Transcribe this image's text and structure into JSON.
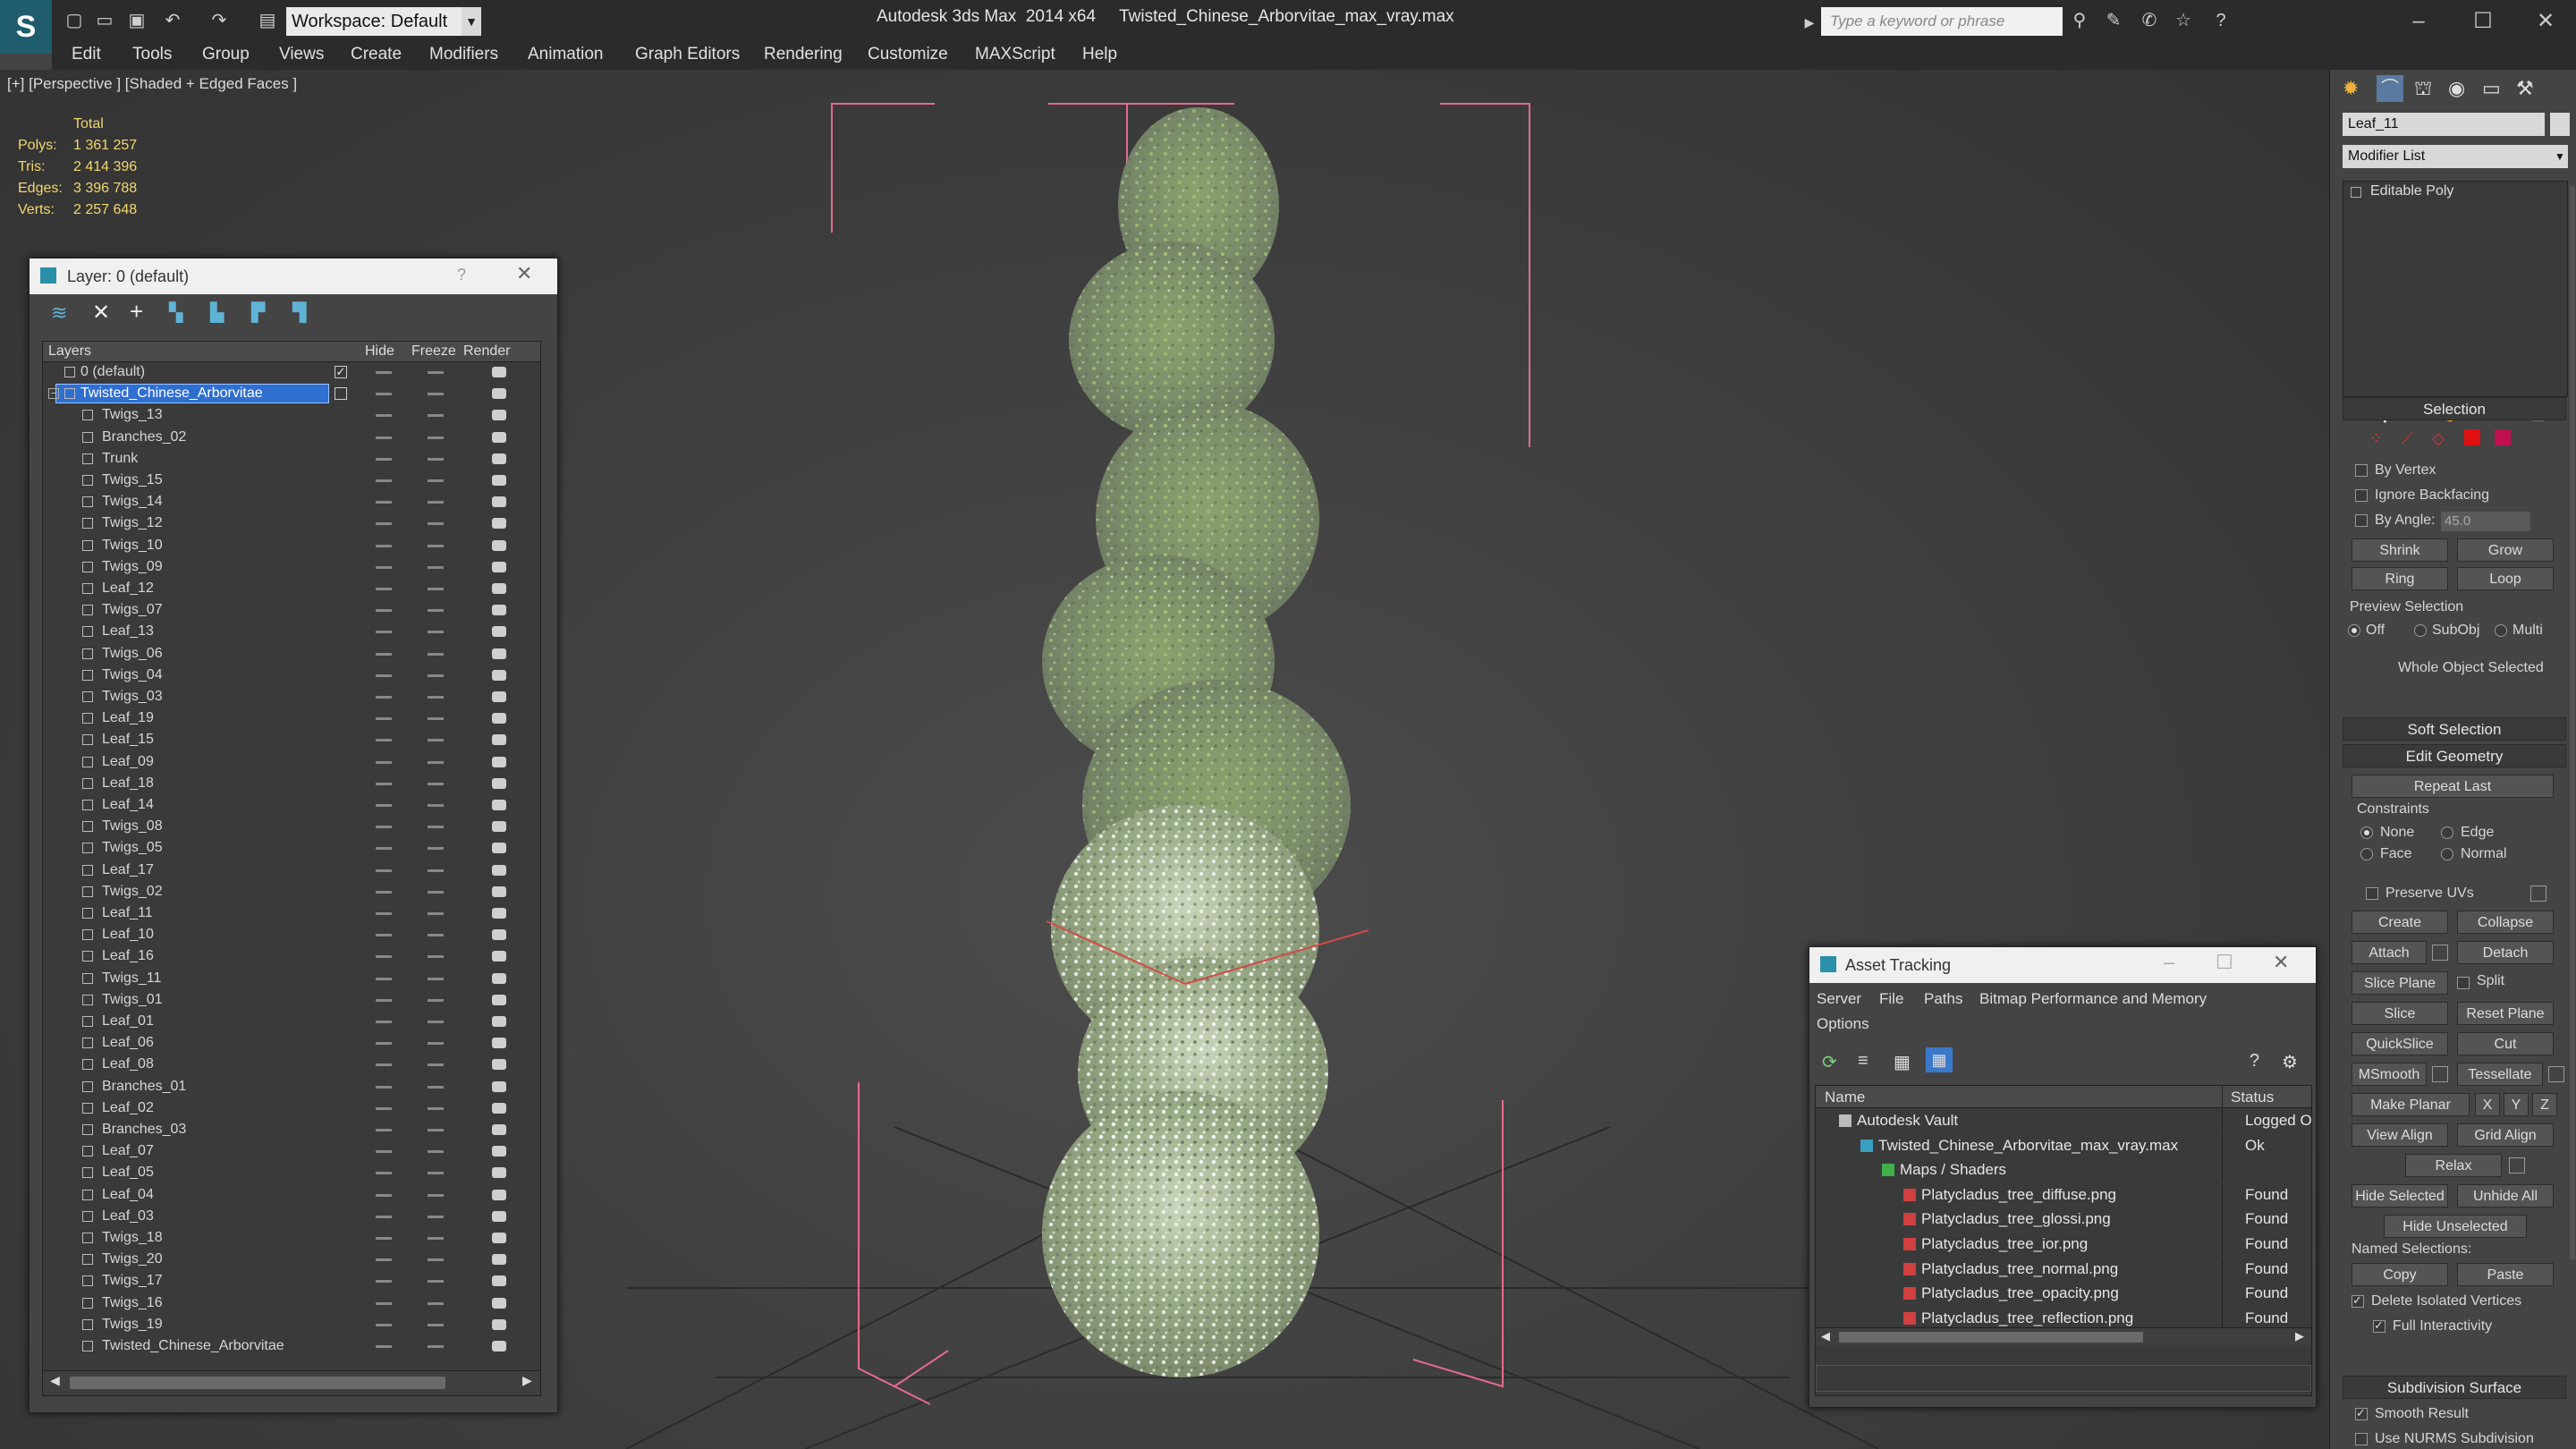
{
  "window": {
    "app_title": "Autodesk 3ds Max  2014 x64",
    "file_title": "Twisted_Chinese_Arborvitae_max_vray.max",
    "workspace": "Workspace: Default",
    "search_placeholder": "Type a keyword or phrase"
  },
  "menu": [
    "Edit",
    "Tools",
    "Group",
    "Views",
    "Create",
    "Modifiers",
    "Animation",
    "Graph Editors",
    "Rendering",
    "Customize",
    "MAXScript",
    "Help"
  ],
  "viewport": {
    "label": "[+] [Perspective ] [Shaded + Edged Faces ]",
    "stats_header": "Total",
    "stats": [
      {
        "label": "Polys:",
        "value": "1 361 257"
      },
      {
        "label": "Tris:",
        "value": "2 414 396"
      },
      {
        "label": "Edges:",
        "value": "3 396 788"
      },
      {
        "label": "Verts:",
        "value": "2 257 648"
      }
    ]
  },
  "layer_panel": {
    "title": "Layer: 0 (default)",
    "help": "?",
    "columns": {
      "layers": "Layers",
      "hide": "Hide",
      "freeze": "Freeze",
      "render": "Render"
    },
    "rows": [
      {
        "name": "0 (default)",
        "level": 0,
        "selected": false,
        "checked": true
      },
      {
        "name": "Twisted_Chinese_Arborvitae",
        "level": 0,
        "selected": true,
        "checked": false
      },
      {
        "name": "Twigs_13",
        "level": 1
      },
      {
        "name": "Branches_02",
        "level": 1
      },
      {
        "name": "Trunk",
        "level": 1
      },
      {
        "name": "Twigs_15",
        "level": 1
      },
      {
        "name": "Twigs_14",
        "level": 1
      },
      {
        "name": "Twigs_12",
        "level": 1
      },
      {
        "name": "Twigs_10",
        "level": 1
      },
      {
        "name": "Twigs_09",
        "level": 1
      },
      {
        "name": "Leaf_12",
        "level": 1
      },
      {
        "name": "Twigs_07",
        "level": 1
      },
      {
        "name": "Leaf_13",
        "level": 1
      },
      {
        "name": "Twigs_06",
        "level": 1
      },
      {
        "name": "Twigs_04",
        "level": 1
      },
      {
        "name": "Twigs_03",
        "level": 1
      },
      {
        "name": "Leaf_19",
        "level": 1
      },
      {
        "name": "Leaf_15",
        "level": 1
      },
      {
        "name": "Leaf_09",
        "level": 1
      },
      {
        "name": "Leaf_18",
        "level": 1
      },
      {
        "name": "Leaf_14",
        "level": 1
      },
      {
        "name": "Twigs_08",
        "level": 1
      },
      {
        "name": "Twigs_05",
        "level": 1
      },
      {
        "name": "Leaf_17",
        "level": 1
      },
      {
        "name": "Twigs_02",
        "level": 1
      },
      {
        "name": "Leaf_11",
        "level": 1
      },
      {
        "name": "Leaf_10",
        "level": 1
      },
      {
        "name": "Leaf_16",
        "level": 1
      },
      {
        "name": "Twigs_11",
        "level": 1
      },
      {
        "name": "Twigs_01",
        "level": 1
      },
      {
        "name": "Leaf_01",
        "level": 1
      },
      {
        "name": "Leaf_06",
        "level": 1
      },
      {
        "name": "Leaf_08",
        "level": 1
      },
      {
        "name": "Branches_01",
        "level": 1
      },
      {
        "name": "Leaf_02",
        "level": 1
      },
      {
        "name": "Branches_03",
        "level": 1
      },
      {
        "name": "Leaf_07",
        "level": 1
      },
      {
        "name": "Leaf_05",
        "level": 1
      },
      {
        "name": "Leaf_04",
        "level": 1
      },
      {
        "name": "Leaf_03",
        "level": 1
      },
      {
        "name": "Twigs_18",
        "level": 1
      },
      {
        "name": "Twigs_20",
        "level": 1
      },
      {
        "name": "Twigs_17",
        "level": 1
      },
      {
        "name": "Twigs_16",
        "level": 1
      },
      {
        "name": "Twigs_19",
        "level": 1
      },
      {
        "name": "Twisted_Chinese_Arborvitae",
        "level": 1
      }
    ]
  },
  "asset_panel": {
    "title": "Asset Tracking",
    "menu": [
      "Server",
      "File",
      "Paths",
      "Bitmap Performance and Memory",
      "Options"
    ],
    "columns": {
      "name": "Name",
      "status": "Status"
    },
    "rows": [
      {
        "name": "Autodesk Vault",
        "status": "Logged O",
        "level": 0,
        "icon": "vault-icon"
      },
      {
        "name": "Twisted_Chinese_Arborvitae_max_vray.max",
        "status": "Ok",
        "level": 1,
        "icon": "max-file-icon"
      },
      {
        "name": "Maps / Shaders",
        "status": "",
        "level": 2,
        "icon": "maps-icon"
      },
      {
        "name": "Platycladus_tree_diffuse.png",
        "status": "Found",
        "level": 3,
        "icon": "png-icon"
      },
      {
        "name": "Platycladus_tree_glossi.png",
        "status": "Found",
        "level": 3,
        "icon": "png-icon"
      },
      {
        "name": "Platycladus_tree_ior.png",
        "status": "Found",
        "level": 3,
        "icon": "png-icon"
      },
      {
        "name": "Platycladus_tree_normal.png",
        "status": "Found",
        "level": 3,
        "icon": "png-icon"
      },
      {
        "name": "Platycladus_tree_opacity.png",
        "status": "Found",
        "level": 3,
        "icon": "png-icon"
      },
      {
        "name": "Platycladus_tree_reflection.png",
        "status": "Found",
        "level": 3,
        "icon": "png-icon"
      }
    ]
  },
  "command_panel": {
    "object_name": "Leaf_11",
    "modifier_list": "Modifier List",
    "stack_item": "Editable Poly",
    "selection": {
      "title": "Selection",
      "by_vertex": "By Vertex",
      "ignore_backfacing": "Ignore Backfacing",
      "by_angle": "By Angle:",
      "angle_value": "45.0",
      "shrink": "Shrink",
      "grow": "Grow",
      "ring": "Ring",
      "loop": "Loop",
      "preview_selection": "Preview Selection",
      "preview_options": [
        "Off",
        "SubObj",
        "Multi"
      ],
      "status": "Whole Object Selected"
    },
    "soft_selection": "Soft Selection",
    "edit_geometry": {
      "title": "Edit Geometry",
      "repeat_last": "Repeat Last",
      "constraints": "Constraints",
      "constraint_options": [
        "None",
        "Edge",
        "Face",
        "Normal"
      ],
      "preserve_uvs": "Preserve UVs",
      "create": "Create",
      "collapse": "Collapse",
      "attach": "Attach",
      "detach": "Detach",
      "slice_plane": "Slice Plane",
      "split": "Split",
      "slice": "Slice",
      "reset_plane": "Reset Plane",
      "quickslice": "QuickSlice",
      "cut": "Cut",
      "msmooth": "MSmooth",
      "tessellate": "Tessellate",
      "make_planar": "Make Planar",
      "x": "X",
      "y": "Y",
      "z": "Z",
      "view_align": "View Align",
      "grid_align": "Grid Align",
      "relax": "Relax",
      "hide_selected": "Hide Selected",
      "unhide_all": "Unhide All",
      "hide_unselected": "Hide Unselected",
      "named_selections": "Named Selections:",
      "copy": "Copy",
      "paste": "Paste",
      "delete_isolated": "Delete Isolated Vertices",
      "full_interactivity": "Full Interactivity"
    },
    "subdivision_surface": {
      "title": "Subdivision Surface",
      "smooth_result": "Smooth Result",
      "use_nurms": "Use NURMS Subdivision"
    }
  },
  "colors": {
    "accent_selected": "#2f6fcf",
    "stat_yellow": "#f2d770",
    "bbox_pink": "#e46b8e"
  }
}
